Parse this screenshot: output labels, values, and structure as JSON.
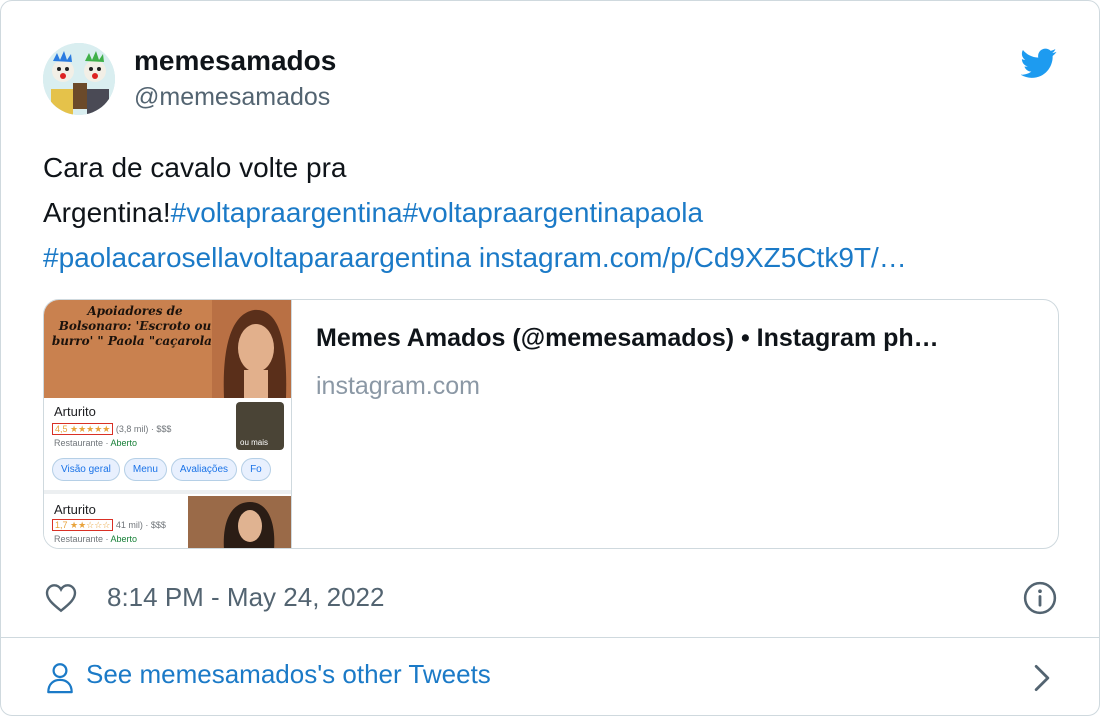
{
  "colors": {
    "link": "#1b7ac7",
    "twitter_blue": "#1d9bf0",
    "secondary_text": "#536471"
  },
  "author": {
    "display_name": "memesamados",
    "handle": "@memesamados"
  },
  "tweet": {
    "text_plain_1": "Cara de cavalo volte pra",
    "text_plain_2": "Argentina!",
    "hashtag_1": "#voltapraargentina",
    "hashtag_2": "#voltapraargentinapaola",
    "hashtag_3": "#paolacarosellavoltaparaargentina",
    "url": "instagram.com/p/Cd9XZ5Ctk9T/…"
  },
  "link_card": {
    "title": "Memes Amados (@memesamados) • Instagram ph…",
    "domain": "instagram.com",
    "thumbnail": {
      "headline": "Apoiadores de Bolsonaro: 'Escroto ou burro' \" Paola \"caçarola\"",
      "place_1": {
        "name": "Arturito",
        "rating": "4,5 ★★★★★",
        "reviews": "(3,8 mil) · $$$",
        "category": "Restaurante",
        "status": "Aberto"
      },
      "chips": [
        "Visão geral",
        "Menu",
        "Avaliações",
        "Fo"
      ],
      "photo_label": "ou mais",
      "place_2": {
        "name": "Arturito",
        "rating": "1,7 ★★☆☆☆",
        "reviews": "41 mil) · $$$",
        "category": "Restaurante",
        "status": "Aberto"
      }
    }
  },
  "footer": {
    "timestamp": "8:14 PM - May 24, 2022",
    "other_tweets_label": "See memesamados's other Tweets"
  },
  "icons": {
    "like": "heart-icon",
    "info": "info-icon",
    "brand": "twitter-bird-icon",
    "profile": "person-icon",
    "navigate": "chevron-right-icon"
  }
}
